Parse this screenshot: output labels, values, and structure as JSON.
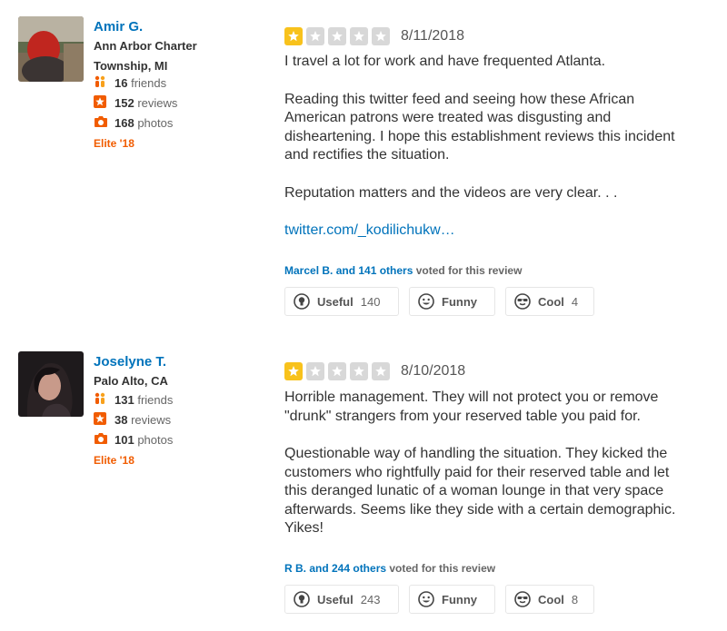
{
  "reviews": [
    {
      "user": {
        "name": "Amir G.",
        "location": "Ann Arbor Charter Township, MI",
        "friends_count": "16",
        "friends_label": "friends",
        "reviews_count": "152",
        "reviews_label": "reviews",
        "photos_count": "168",
        "photos_label": "photos",
        "elite": "Elite '18"
      },
      "rating": 1,
      "date": "8/11/2018",
      "paragraphs": [
        "I travel a lot for work and have frequented Atlanta.",
        "Reading this twitter feed and seeing how these African American patrons were treated was disgusting and disheartening. I hope this establishment reviews this incident and rectifies the situation.",
        "Reputation matters and the videos are very clear. . ."
      ],
      "link": "twitter.com/_kodilichukw…",
      "voters": "Marcel B. and 141 others",
      "voted_suffix": "voted for this review",
      "buttons": {
        "useful_label": "Useful",
        "useful_count": "140",
        "funny_label": "Funny",
        "funny_count": "",
        "cool_label": "Cool",
        "cool_count": "4"
      }
    },
    {
      "user": {
        "name": "Joselyne T.",
        "location": "Palo Alto, CA",
        "friends_count": "131",
        "friends_label": "friends",
        "reviews_count": "38",
        "reviews_label": "reviews",
        "photos_count": "101",
        "photos_label": "photos",
        "elite": "Elite '18"
      },
      "rating": 1,
      "date": "8/10/2018",
      "paragraphs": [
        "Horrible management. They will not protect you or remove \"drunk\" strangers from your reserved table you paid for.",
        "Questionable way of handling the situation. They kicked the customers who rightfully paid for their reserved table and let this deranged lunatic of a woman lounge in that very space afterwards. Seems like they side with a certain demographic. Yikes!"
      ],
      "link": "",
      "voters": "R B. and 244 others",
      "voted_suffix": "voted for this review",
      "buttons": {
        "useful_label": "Useful",
        "useful_count": "243",
        "funny_label": "Funny",
        "funny_count": "",
        "cool_label": "Cool",
        "cool_count": "8"
      }
    }
  ],
  "colors": {
    "link": "#0073bb",
    "elite": "#f15c00",
    "star_on": "#f8c21c",
    "star_off": "#d8d8d8"
  },
  "icons": {
    "friends": "friends-icon",
    "reviews": "review-star-icon",
    "photos": "camera-icon",
    "useful": "lightbulb-icon",
    "funny": "smiley-icon",
    "cool": "sunglasses-icon"
  }
}
